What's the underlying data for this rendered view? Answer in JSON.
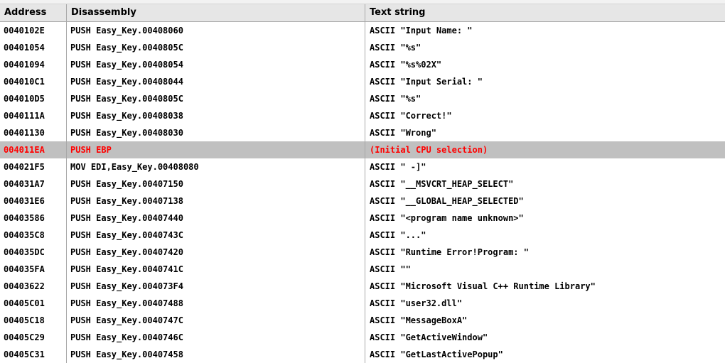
{
  "columns": {
    "address": "Address",
    "disassembly": "Disassembly",
    "text": "Text string"
  },
  "rows": [
    {
      "address": "0040102E",
      "disassembly": "PUSH Easy_Key.00408060",
      "text": "ASCII \"Input Name: \""
    },
    {
      "address": "00401054",
      "disassembly": "PUSH Easy_Key.0040805C",
      "text": "ASCII \"%s\""
    },
    {
      "address": "00401094",
      "disassembly": "PUSH Easy_Key.00408054",
      "text": "ASCII \"%s%02X\""
    },
    {
      "address": "004010C1",
      "disassembly": "PUSH Easy_Key.00408044",
      "text": "ASCII \"Input Serial: \""
    },
    {
      "address": "004010D5",
      "disassembly": "PUSH Easy_Key.0040805C",
      "text": "ASCII \"%s\""
    },
    {
      "address": "0040111A",
      "disassembly": "PUSH Easy_Key.00408038",
      "text": "ASCII \"Correct!\""
    },
    {
      "address": "00401130",
      "disassembly": "PUSH Easy_Key.00408030",
      "text": "ASCII \"Wrong\""
    },
    {
      "address": "004011EA",
      "disassembly": "PUSH EBP",
      "text": "(Initial CPU selection)",
      "selected": true
    },
    {
      "address": "004021F5",
      "disassembly": "MOV EDI,Easy_Key.00408080",
      "text": "ASCII \" -]\""
    },
    {
      "address": "004031A7",
      "disassembly": "PUSH Easy_Key.00407150",
      "text": "ASCII \"__MSVCRT_HEAP_SELECT\""
    },
    {
      "address": "004031E6",
      "disassembly": "PUSH Easy_Key.00407138",
      "text": "ASCII \"__GLOBAL_HEAP_SELECTED\""
    },
    {
      "address": "00403586",
      "disassembly": "PUSH Easy_Key.00407440",
      "text": "ASCII \"<program name unknown>\""
    },
    {
      "address": "004035C8",
      "disassembly": "PUSH Easy_Key.0040743C",
      "text": "ASCII \"...\""
    },
    {
      "address": "004035DC",
      "disassembly": "PUSH Easy_Key.00407420",
      "text": "ASCII \"Runtime Error!Program: \""
    },
    {
      "address": "004035FA",
      "disassembly": "PUSH Easy_Key.0040741C",
      "text": "ASCII \"\""
    },
    {
      "address": "00403622",
      "disassembly": "PUSH Easy_Key.004073F4",
      "text": "ASCII \"Microsoft Visual C++ Runtime Library\""
    },
    {
      "address": "00405C01",
      "disassembly": "PUSH Easy_Key.00407488",
      "text": "ASCII \"user32.dll\""
    },
    {
      "address": "00405C18",
      "disassembly": "PUSH Easy_Key.0040747C",
      "text": "ASCII \"MessageBoxA\""
    },
    {
      "address": "00405C29",
      "disassembly": "PUSH Easy_Key.0040746C",
      "text": "ASCII \"GetActiveWindow\""
    },
    {
      "address": "00405C31",
      "disassembly": "PUSH Easy_Key.00407458",
      "text": "ASCII \"GetLastActivePopup\""
    }
  ],
  "colors": {
    "selected_text": "#ff0000",
    "selected_background": "#c0c0c0",
    "header_background": "#e6e6e6",
    "grid_line": "#a8a8a8"
  }
}
